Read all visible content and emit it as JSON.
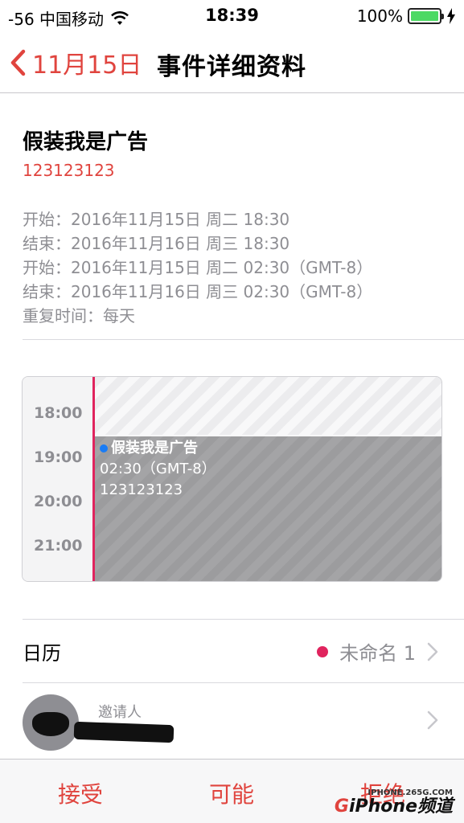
{
  "status_bar": {
    "carrier": "-56 中国移动",
    "time": "18:39",
    "battery": "100%",
    "wifi_icon": "wifi-icon",
    "battery_icon": "battery-icon",
    "charging_icon": "charging-bolt-icon"
  },
  "nav": {
    "back_label": "11月15日",
    "title": "事件详细资料"
  },
  "event": {
    "title": "假装我是广告",
    "location": "123123123",
    "times": [
      "开始：2016年11月15日 周二 18:30",
      "结束：2016年11月16日 周三 18:30",
      "开始：2016年11月15日 周二 02:30（GMT-8）",
      "结束：2016年11月16日 周三 02:30（GMT-8）",
      "重复时间：每天"
    ]
  },
  "calendar_preview": {
    "hours": [
      "18:00",
      "19:00",
      "20:00",
      "21:00"
    ],
    "event_title": "假装我是广告",
    "event_time": "02:30（GMT-8）",
    "event_location": "123123123",
    "dot_color": "#1a7cf5",
    "line_color": "#e0245e"
  },
  "calendar_row": {
    "label": "日历",
    "value": "未命名 1",
    "dot_color": "#e0245e"
  },
  "invitee_row": {
    "label": "邀请人"
  },
  "toolbar": {
    "accept": "接受",
    "maybe": "可能",
    "decline": "拒绝"
  },
  "watermark": {
    "small": "IPHONE.265G.COM",
    "big_g": "G",
    "big_rest": "iPhone频道"
  },
  "colors": {
    "accent": "#e0443e",
    "calendar_pink": "#e0245e"
  }
}
